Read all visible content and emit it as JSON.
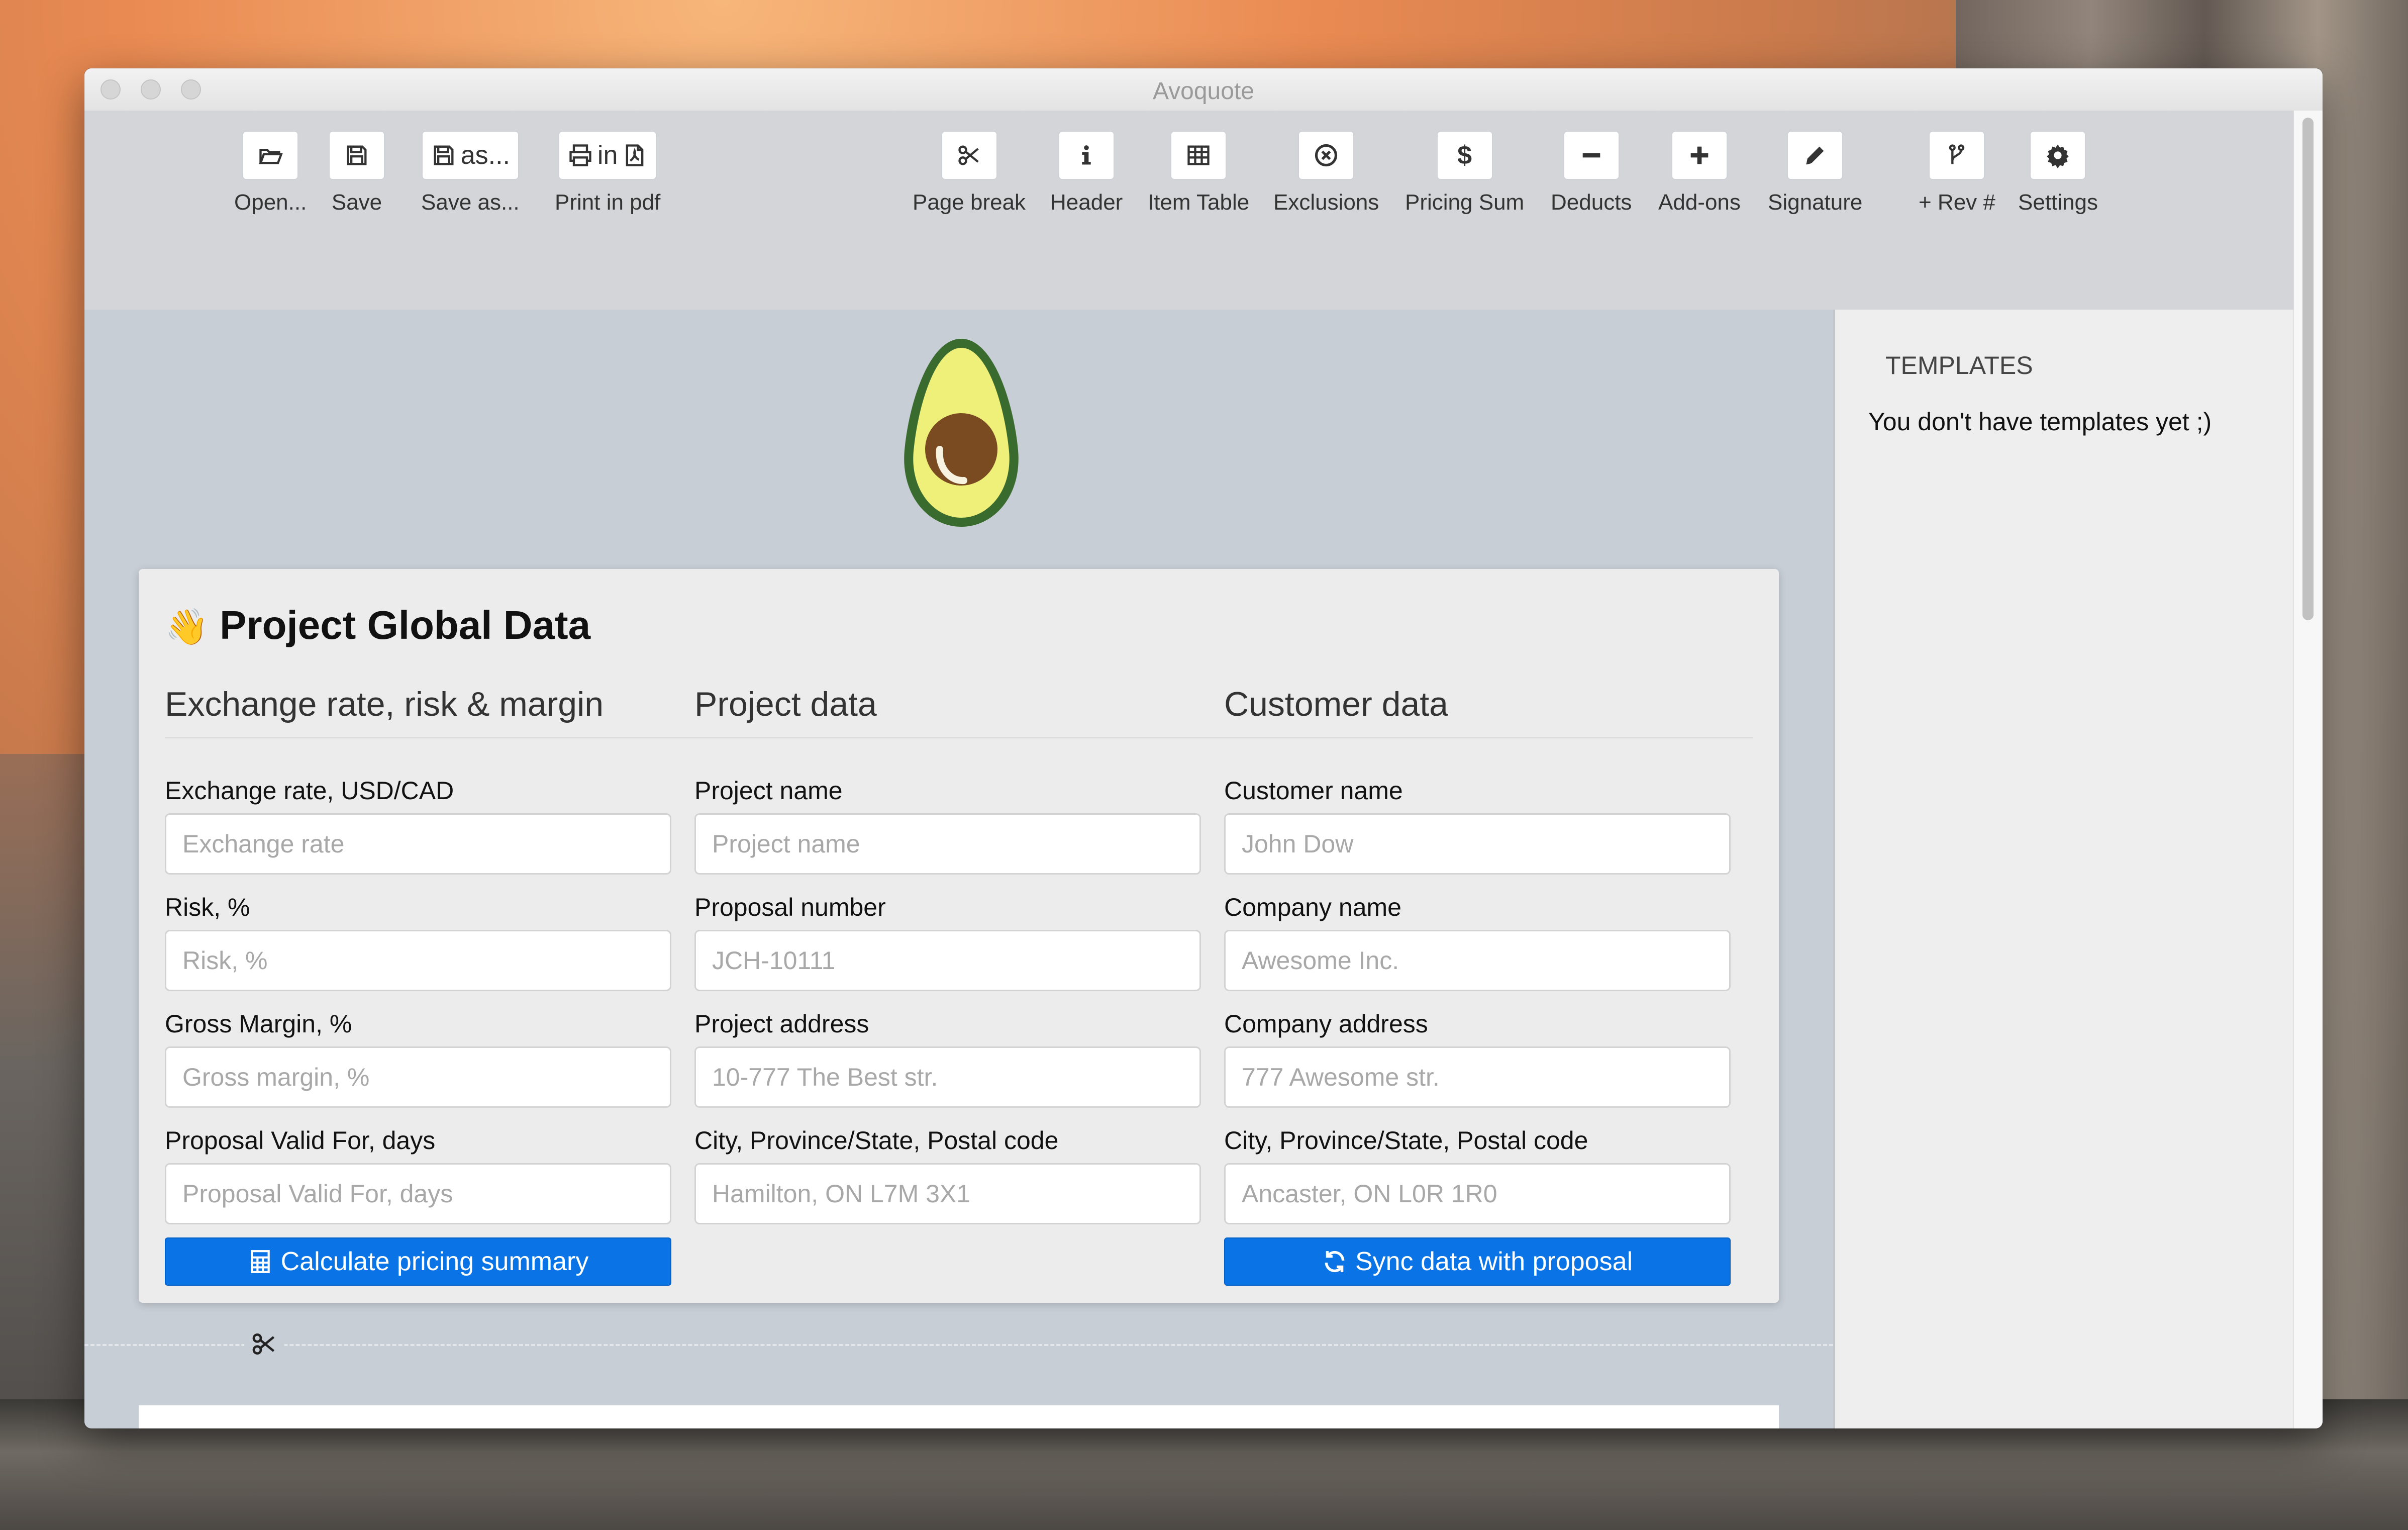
{
  "window": {
    "title": "Avoquote"
  },
  "toolbar": {
    "groups": [
      [
        {
          "id": "open",
          "label": "Open...",
          "icon": "folder-open-icon"
        },
        {
          "id": "save",
          "label": "Save",
          "icon": "floppy-icon"
        },
        {
          "id": "save_as",
          "label": "Save as...",
          "icon": "floppy-icon",
          "button_text": "as..."
        },
        {
          "id": "print_pdf",
          "label": "Print in pdf",
          "icon": "print-icon",
          "button_text": "in"
        }
      ],
      [
        {
          "id": "page_break",
          "label": "Page break",
          "icon": "scissors-icon"
        },
        {
          "id": "header",
          "label": "Header",
          "icon": "info-icon"
        },
        {
          "id": "item_table",
          "label": "Item Table",
          "icon": "table-icon"
        },
        {
          "id": "exclusions",
          "label": "Exclusions",
          "icon": "circle-x-icon"
        },
        {
          "id": "pricing_sum",
          "label": "Pricing Sum",
          "icon": "dollar-icon"
        },
        {
          "id": "deducts",
          "label": "Deducts",
          "icon": "minus-icon"
        },
        {
          "id": "addons",
          "label": "Add-ons",
          "icon": "plus-icon"
        },
        {
          "id": "signature",
          "label": "Signature",
          "icon": "pencil-icon"
        }
      ],
      [
        {
          "id": "rev",
          "label": "+ Rev #",
          "icon": "branch-icon"
        },
        {
          "id": "settings",
          "label": "Settings",
          "icon": "gear-icon"
        }
      ]
    ]
  },
  "card": {
    "title_emoji": "👋",
    "title": "Project Global Data",
    "columns": [
      {
        "heading": "Exchange rate, risk & margin",
        "fields": [
          {
            "label": "Exchange rate, USD/CAD",
            "placeholder": "Exchange rate"
          },
          {
            "label": "Risk, %",
            "placeholder": "Risk, %"
          },
          {
            "label": "Gross Margin, %",
            "placeholder": "Gross margin, %"
          },
          {
            "label": "Proposal Valid For, days",
            "placeholder": "Proposal Valid For, days"
          }
        ],
        "button": "Calculate pricing summary"
      },
      {
        "heading": "Project data",
        "fields": [
          {
            "label": "Project name",
            "placeholder": "Project name"
          },
          {
            "label": "Proposal number",
            "placeholder": "JCH-10111"
          },
          {
            "label": "Project address",
            "placeholder": "10-777 The Best str."
          },
          {
            "label": "City, Province/State, Postal code",
            "placeholder": "Hamilton, ON L7M 3X1"
          }
        ]
      },
      {
        "heading": "Customer data",
        "fields": [
          {
            "label": "Customer name",
            "placeholder": "John Dow"
          },
          {
            "label": "Company name",
            "placeholder": "Awesome Inc."
          },
          {
            "label": "Company address",
            "placeholder": "777 Awesome str."
          },
          {
            "label": "City, Province/State, Postal code",
            "placeholder": "Ancaster, ON L0R 1R0"
          }
        ],
        "button": "Sync data with proposal"
      }
    ]
  },
  "sidebar": {
    "title": "TEMPLATES",
    "empty_message": "You don't have templates yet ;)"
  },
  "colors": {
    "primary": "#0a73e6",
    "avocado_skin": "#3a6b2e",
    "avocado_flesh": "#eef07a",
    "avocado_pit": "#7a4a20"
  }
}
